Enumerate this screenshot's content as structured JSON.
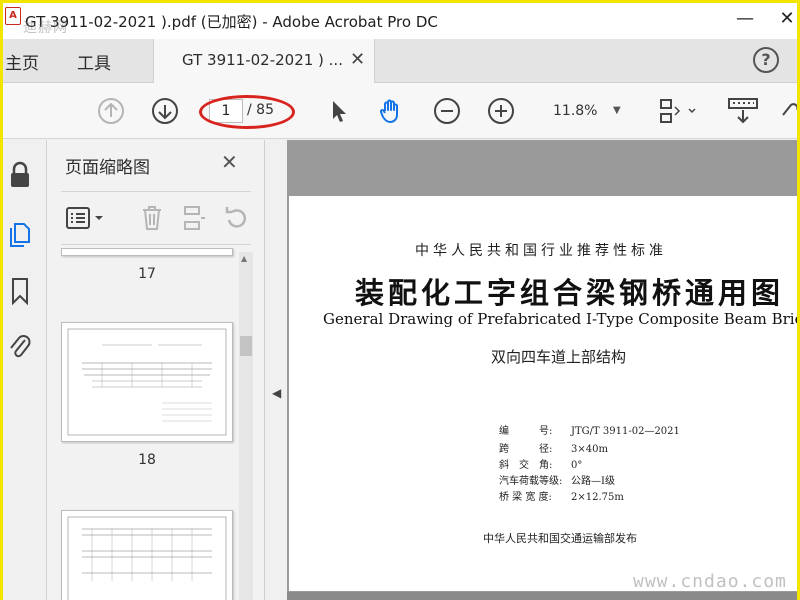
{
  "window": {
    "title": "GT 3911-02-2021 ).pdf (已加密) - Adobe Acrobat Pro DC",
    "watermark": "迪赫网",
    "minimize": "—",
    "close": "✕"
  },
  "menu": {
    "home": "主页",
    "tools": "工具",
    "tab_label": "GT 3911-02-2021 ) ...",
    "tab_close": "✕",
    "help": "?"
  },
  "toolbar": {
    "current_page": "1",
    "total_pages": "/ 85",
    "zoom": "11.8%"
  },
  "thumbnails_panel": {
    "title": "页面缩略图",
    "close": "✕",
    "pages": [
      {
        "number": "17"
      },
      {
        "number": "18"
      }
    ]
  },
  "document": {
    "subtitle": "中华人民共和国行业推荐性标准",
    "title": "装配化工字组合梁钢桥通用图",
    "title_en": "General Drawing of Prefabricated I-Type Composite Beam Bridg",
    "part": "双向四车道上部结构",
    "specs": [
      {
        "key": "编　　　号:",
        "value": "JTG/T 3911-02—2021"
      },
      {
        "key": "跨　　　径:",
        "value": "3×40m"
      },
      {
        "key": "斜　交　角:",
        "value": "0°"
      },
      {
        "key": "汽车荷载等级:",
        "value": "公路—Ⅰ级"
      },
      {
        "key": "桥 梁 宽 度:",
        "value": "2×12.75m"
      }
    ],
    "publisher": "中华人民共和国交通运输部发布"
  },
  "site_watermark": "www.cndao.com",
  "colors": {
    "highlight_ellipse": "#d9231f",
    "hand_tool": "#1473e6",
    "doc_background": "#9a9a9a"
  }
}
